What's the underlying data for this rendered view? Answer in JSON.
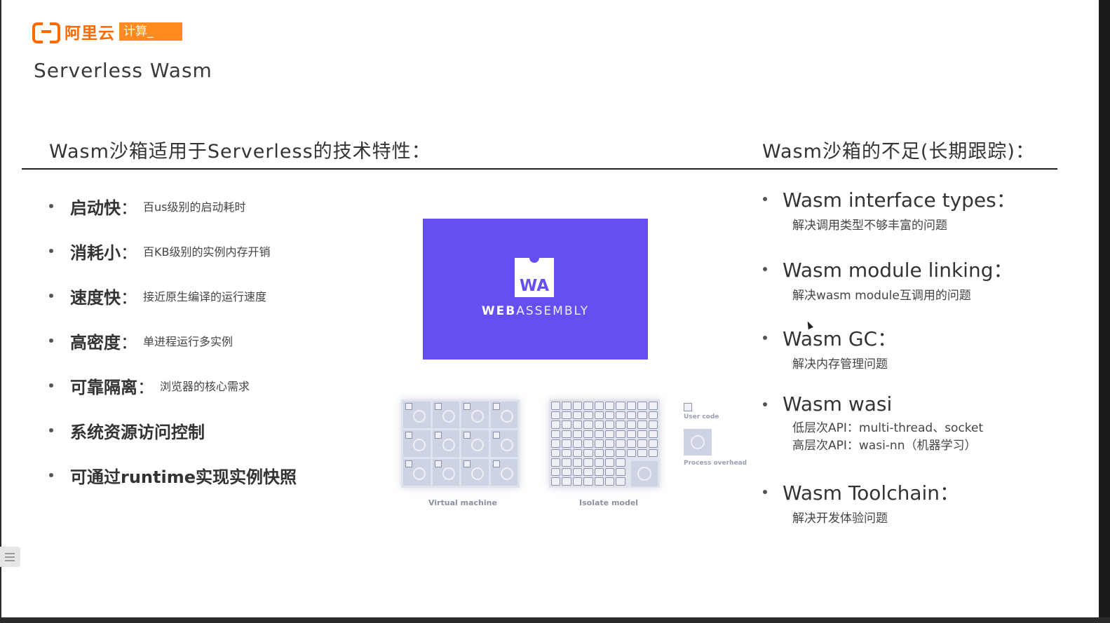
{
  "logo": {
    "text": "阿里云",
    "tag": "计算_"
  },
  "page_title": "Serverless Wasm",
  "sections": {
    "left_title": "Wasm沙箱适用于Serverless的技术特性：",
    "right_title": "Wasm沙箱的不足(长期跟踪)："
  },
  "features": [
    {
      "name": "启动快",
      "colon": "：",
      "desc": "百us级别的启动耗时"
    },
    {
      "name": "消耗小",
      "colon": "：",
      "desc": "百KB级别的实例内存开销"
    },
    {
      "name": "速度快",
      "colon": "：",
      "desc": "接近原生编译的运行速度"
    },
    {
      "name": "高密度",
      "colon": "：",
      "desc": "单进程运行多实例"
    },
    {
      "name": "可靠隔离",
      "colon": "：",
      "desc": "浏览器的核心需求"
    },
    {
      "name": "系统资源访问控制",
      "colon": "",
      "desc": ""
    },
    {
      "name": "可通过runtime实现实例快照",
      "colon": "",
      "desc": ""
    }
  ],
  "wasm_logo": {
    "letters": "WA",
    "word_bold": "WEB",
    "word_light": "ASSEMBLY",
    "color": "#654ff0"
  },
  "diagram": {
    "vm_caption": "Virtual machine",
    "isolate_caption": "Isolate model",
    "legend_user": "User code",
    "legend_overhead": "Process overhead"
  },
  "gaps": [
    {
      "title": "Wasm interface types：",
      "desc": [
        "解决调用类型不够丰富的问题"
      ]
    },
    {
      "title": "Wasm module linking：",
      "desc": [
        "解决wasm module互调用的问题"
      ]
    },
    {
      "title": "Wasm GC：",
      "desc": [
        "解决内存管理问题"
      ]
    },
    {
      "title": "Wasm wasi",
      "desc": [
        "低层次API：multi-thread、socket",
        "高层次API：wasi-nn（机器学习）"
      ]
    },
    {
      "title": "Wasm Toolchain：",
      "desc": [
        "解决开发体验问题"
      ]
    }
  ],
  "colors": {
    "brand_orange": "#ff6a00",
    "text": "#333333"
  }
}
